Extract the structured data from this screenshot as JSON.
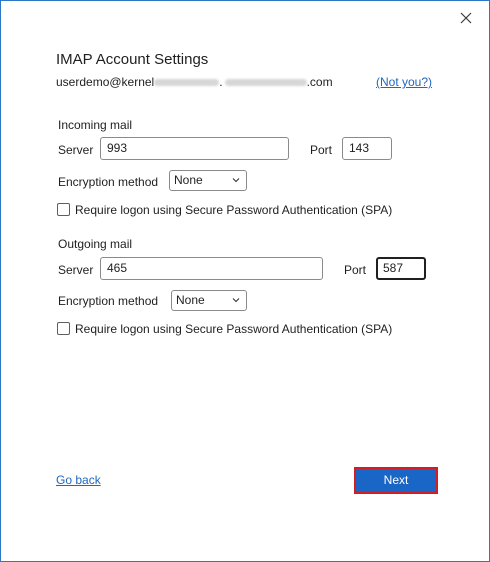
{
  "dialog": {
    "title": "IMAP Account Settings",
    "account_prefix": "userdemo@kernel",
    "account_suffix": ".com",
    "account_dot": ".",
    "not_you_label": "(Not you?)"
  },
  "incoming": {
    "heading": "Incoming mail",
    "server_label": "Server",
    "server_value": "993",
    "port_label": "Port",
    "port_value": "143",
    "encryption_label": "Encryption method",
    "encryption_value": "None",
    "spa_label": "Require logon using Secure Password Authentication (SPA)",
    "spa_checked": false
  },
  "outgoing": {
    "heading": "Outgoing mail",
    "server_label": "Server",
    "server_value": "465",
    "port_label": "Port",
    "port_value": "587",
    "encryption_label": "Encryption method",
    "encryption_value": "None",
    "spa_label": "Require logon using Secure Password Authentication (SPA)",
    "spa_checked": false
  },
  "footer": {
    "go_back_label": "Go back",
    "next_label": "Next"
  },
  "colors": {
    "accent": "#1a66c6",
    "link": "#2167c1",
    "highlight_border": "#d21d24"
  }
}
